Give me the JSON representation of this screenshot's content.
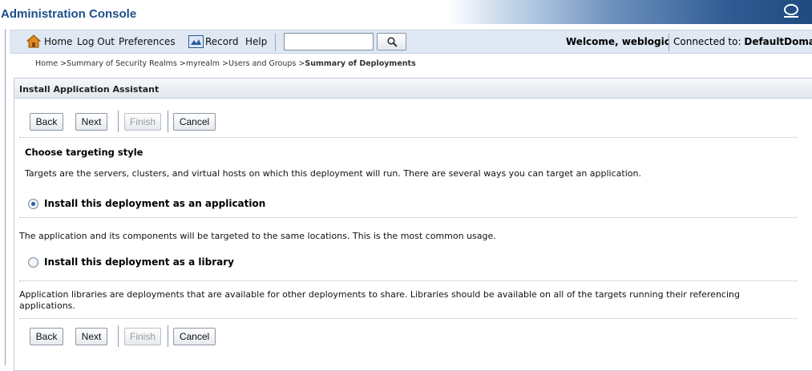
{
  "app": {
    "title": "Administration Console"
  },
  "toolbar": {
    "home": "Home",
    "logout": "Log Out",
    "preferences": "Preferences",
    "record": "Record",
    "help": "Help",
    "search_value": "",
    "welcome_prefix": "Welcome,",
    "welcome_user": "weblogic",
    "connected_prefix": "Connected to:",
    "connected_domain": "DefaultDomain"
  },
  "breadcrumb": {
    "items": [
      "Home",
      "Summary of Security Realms",
      "myrealm",
      "Users and Groups"
    ],
    "current": "Summary of Deployments",
    "separator": " >"
  },
  "panel": {
    "title": "Install Application Assistant",
    "buttons": {
      "back": "Back",
      "next": "Next",
      "finish": "Finish",
      "cancel": "Cancel"
    },
    "heading": "Choose targeting style",
    "description": "Targets are the servers, clusters, and virtual hosts on which this deployment will run. There are several ways you can target an application.",
    "options": [
      {
        "label": "Install this deployment as an application",
        "selected": true,
        "description": "The application and its components will be targeted to the same locations. This is the most common usage."
      },
      {
        "label": "Install this deployment as a library",
        "selected": false,
        "description": "Application libraries are deployments that are available for other deployments to share. Libraries should be available on all of the targets running their referencing applications."
      }
    ]
  },
  "icons": {
    "home": "home-icon",
    "record": "record-icon",
    "search": "search-icon",
    "oracle": "oracle-logo-icon"
  },
  "colors": {
    "title": "#1d4f8a",
    "toolbar": "#dfe8f3",
    "radio_selected": "#2b5da3"
  }
}
